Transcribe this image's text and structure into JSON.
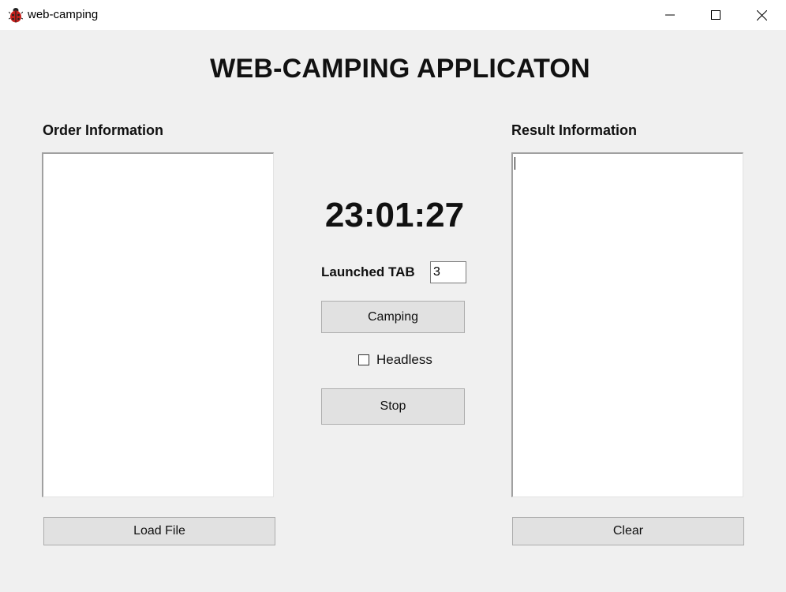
{
  "window": {
    "title": "web-camping",
    "icon": "ladybug-icon"
  },
  "header": {
    "heading": "WEB-CAMPING APPLICATON"
  },
  "order_panel": {
    "label": "Order Information",
    "content": "",
    "load_button_label": "Load File"
  },
  "center": {
    "clock": "23:01:27",
    "launched_tab_label": "Launched TAB",
    "launched_tab_value": "3",
    "camping_button_label": "Camping",
    "headless_label": "Headless",
    "headless_checked": false,
    "stop_button_label": "Stop"
  },
  "result_panel": {
    "label": "Result Information",
    "content": "",
    "clear_button_label": "Clear"
  },
  "colors": {
    "background": "#f0f0f0",
    "button_face": "#e1e1e1",
    "button_border": "#adadad"
  }
}
